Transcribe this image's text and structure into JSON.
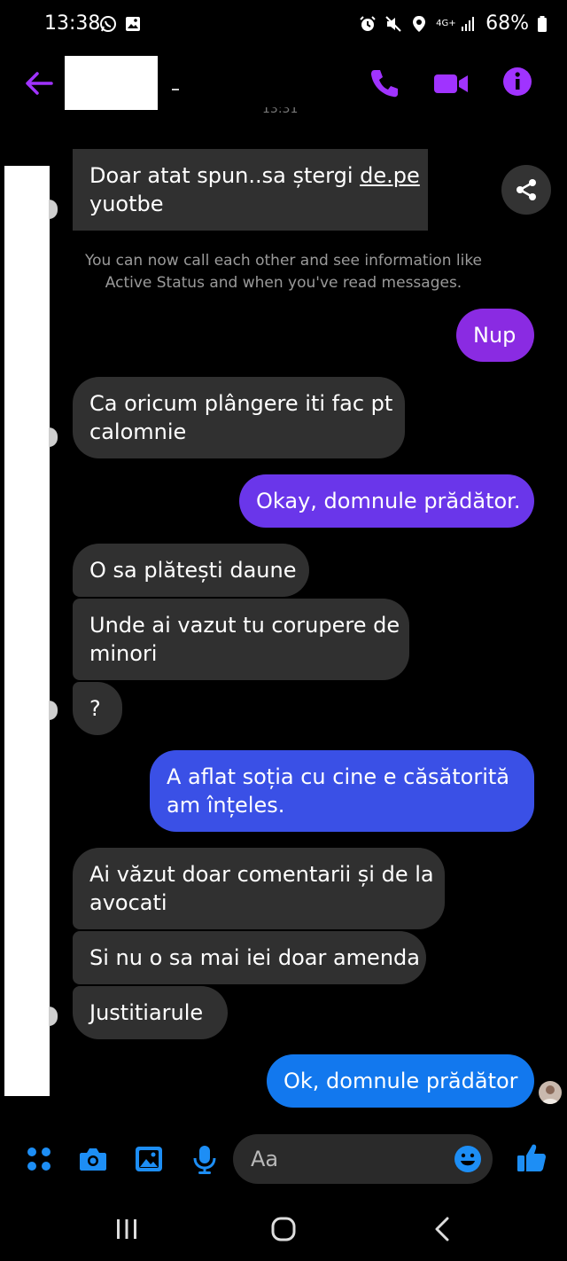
{
  "status_bar": {
    "time": "13:38",
    "network": "4G+",
    "battery": "68%"
  },
  "colors": {
    "accent": "#a033ff",
    "incoming_bubble": "#303030",
    "composer_icon": "#1d8ef5"
  },
  "icons": {
    "header": [
      "arrow-left-icon",
      "phone-icon",
      "video-camera-icon",
      "info-icon"
    ],
    "composer": [
      "grid-menu-icon",
      "camera-icon",
      "gallery-icon",
      "microphone-icon",
      "emoji-icon",
      "thumbs-up-icon"
    ],
    "navigation": [
      "recent-apps-icon",
      "home-icon",
      "back-icon"
    ]
  },
  "messages": [
    {
      "sender": "them",
      "text_prefix": "Doar atat spun..sa ștergi ",
      "link": "de.pe",
      "text_second_line": "yuotbe"
    },
    {
      "sender": "system",
      "text": "You can now call each other and see information like Active Status and when you've read messages."
    },
    {
      "sender": "me",
      "text": "Nup"
    },
    {
      "sender": "them",
      "line1": "Ca oricum plângere iti fac pt",
      "line2": "calomnie"
    },
    {
      "sender": "me",
      "text": "Okay, domnule prădător."
    },
    {
      "sender": "them",
      "text": "O sa plătești daune"
    },
    {
      "sender": "them",
      "line1": "Unde ai vazut tu corupere de",
      "line2": "minori"
    },
    {
      "sender": "them",
      "text": "?"
    },
    {
      "sender": "me",
      "line1": "A aflat soția cu cine e căsătorită",
      "line2": "am înțeles."
    },
    {
      "sender": "them",
      "line1": "Ai văzut doar comentarii și de la",
      "line2": "avocati"
    },
    {
      "sender": "them",
      "text": "Si nu o sa mai iei doar amenda"
    },
    {
      "sender": "them",
      "text": "Justitiarule"
    },
    {
      "sender": "me",
      "text": "Ok, domnule prădător"
    }
  ],
  "composer": {
    "placeholder": "Aa"
  }
}
